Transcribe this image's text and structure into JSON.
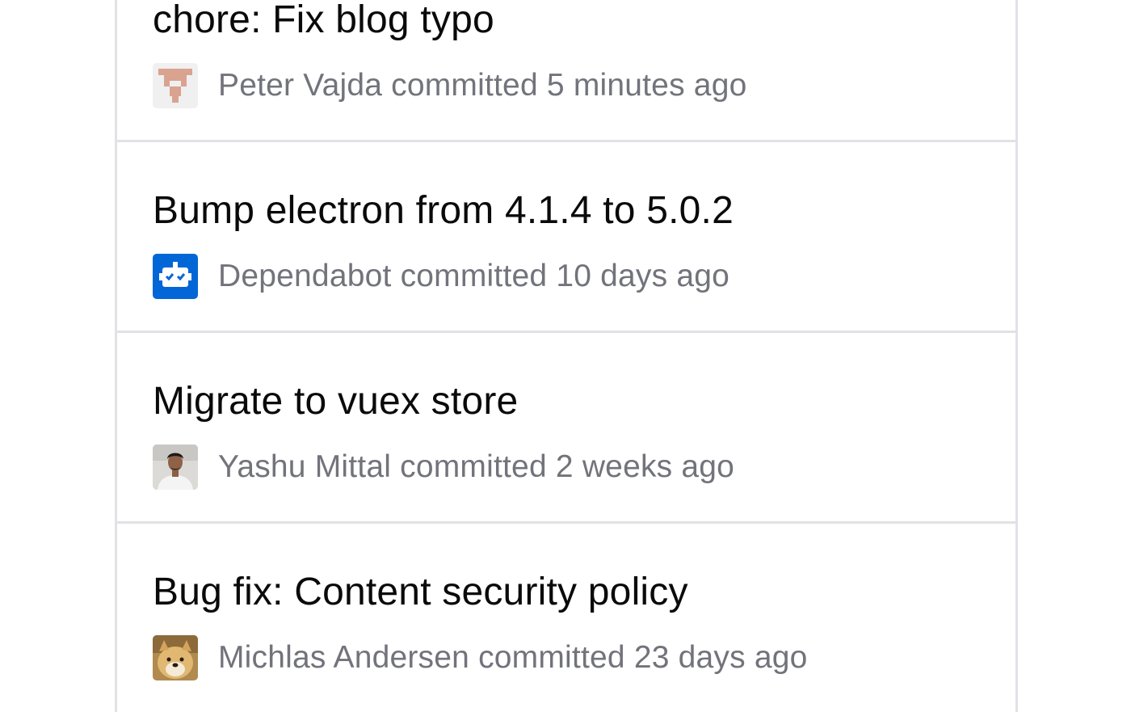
{
  "commits": [
    {
      "message": "chore: Fix blog typo",
      "author": "Peter Vajda",
      "verb": "committed",
      "time": "5 minutes ago",
      "avatar_icon": "identicon-avatar",
      "avatar_color": "#d9a38f"
    },
    {
      "message": "Bump electron from 4.1.4 to 5.0.2",
      "author": "Dependabot",
      "verb": "committed",
      "time": "10 days ago",
      "avatar_icon": "dependabot-robot-icon",
      "avatar_color": "#0366d6"
    },
    {
      "message": "Migrate to vuex store",
      "author": "Yashu Mittal",
      "verb": "committed",
      "time": "2 weeks ago",
      "avatar_icon": "user-photo-avatar",
      "avatar_color": "#d8d6d2"
    },
    {
      "message": "Bug fix: Content security policy",
      "author": "Michlas Andersen",
      "verb": "committed",
      "time": "23 days ago",
      "avatar_icon": "doge-photo-avatar",
      "avatar_color": "#c9a05a"
    }
  ]
}
